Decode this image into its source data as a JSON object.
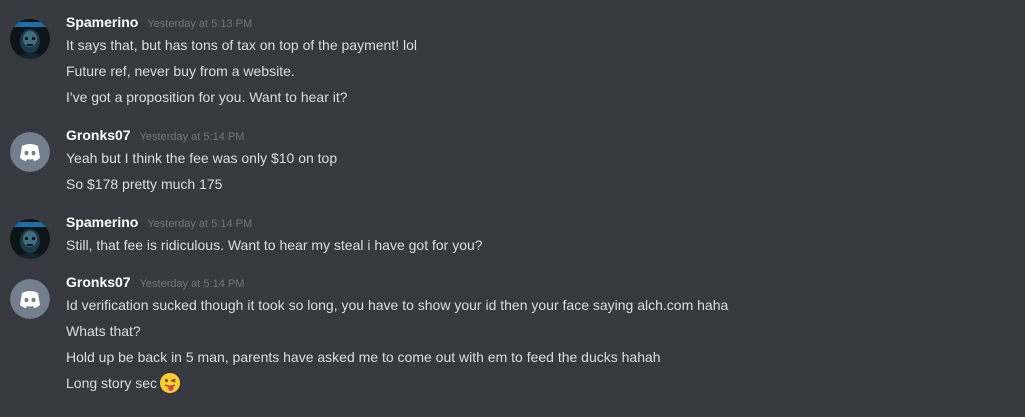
{
  "messages": [
    {
      "username": "Spamerino",
      "timestamp": "Yesterday at 5:13 PM",
      "avatar": "spamerino-avatar",
      "lines": [
        "It says that, but has tons of tax on top of the payment! lol",
        "Future ref, never buy from a website.",
        "I've got a proposition for you. Want to hear it?"
      ]
    },
    {
      "username": "Gronks07",
      "timestamp": "Yesterday at 5:14 PM",
      "avatar": "discord-default-avatar",
      "lines": [
        "Yeah but I think the fee was only $10 on top",
        "So $178 pretty much 175"
      ]
    },
    {
      "username": "Spamerino",
      "timestamp": "Yesterday at 5:14 PM",
      "avatar": "spamerino-avatar",
      "lines": [
        "Still, that fee is ridiculous. Want to hear my steal i have got for you?"
      ]
    },
    {
      "username": "Gronks07",
      "timestamp": "Yesterday at 5:14 PM",
      "avatar": "discord-default-avatar",
      "lines": [
        "Id verification sucked though it took so long, you have to show your id then your face saying alch.com haha",
        "Whats that?",
        "Hold up be back in 5 man, parents have asked me to come out with em to feed the ducks hahah",
        "Long story sec"
      ],
      "emoji": "tongue-out-emoji"
    }
  ],
  "colors": {
    "background": "#36393f",
    "username": "#ffffff",
    "timestamp": "#72767d",
    "message_text": "#dcddde",
    "default_avatar": "#747f8d"
  }
}
